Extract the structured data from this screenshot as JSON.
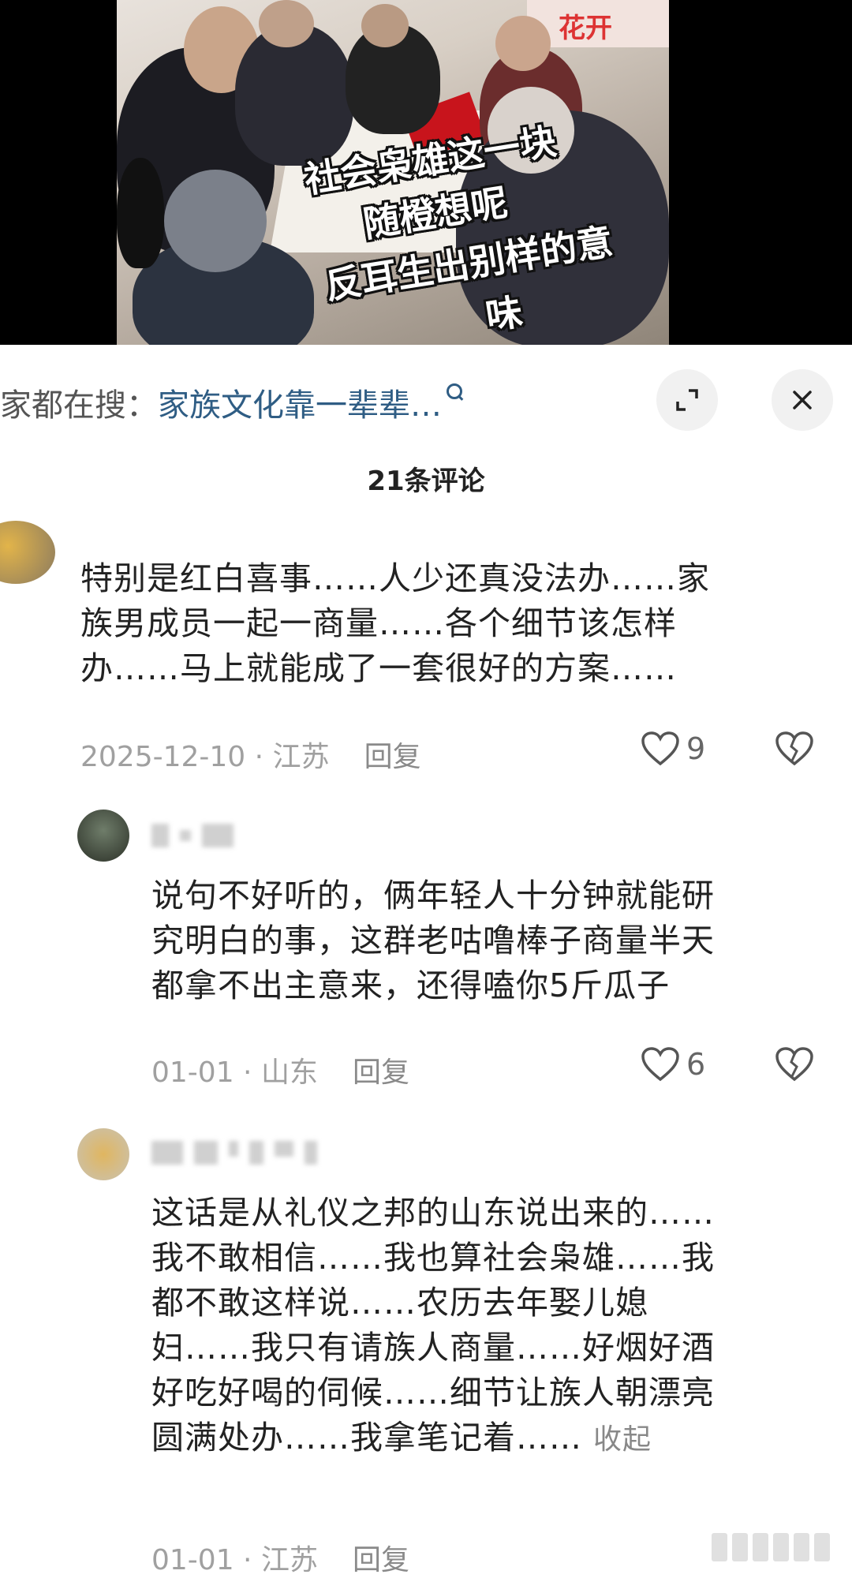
{
  "video": {
    "overlay_lines": [
      "社会枭雄这一块",
      "随橙想呢",
      "反耳生出别样的意",
      "味"
    ],
    "banner_text": "花开"
  },
  "search": {
    "prefix": "家都在搜：",
    "term": "家族文化靠一辈辈…"
  },
  "buttons": {
    "expand_icon": "expand-icon",
    "close_icon": "close-icon"
  },
  "comments_header": "21条评论",
  "comments": [
    {
      "lines": [
        "特别是红白喜事……人少还真没法办……家",
        "族男成员一起一商量……各个细节该怎样",
        "办……马上就能成了一套很好的方案……"
      ],
      "date": "2025-12-10",
      "region": "江苏",
      "reply": "回复",
      "likes": "9"
    },
    {
      "lines": [
        "说句不好听的，俩年轻人十分钟就能研",
        "究明白的事，这群老咕噜棒子商量半天",
        "都拿不出主意来，还得嗑你5斤瓜子"
      ],
      "date": "01-01",
      "region": "山东",
      "reply": "回复",
      "likes": "6"
    },
    {
      "lines": [
        "这话是从礼仪之邦的山东说出来的……",
        "我不敢相信……我也算社会枭雄……我",
        "都不敢这样说……农历去年娶儿媳",
        "妇……我只有请族人商量……好烟好酒",
        "好吃好喝的伺候……细节让族人朝漂亮",
        "圆满处办……我拿笔记着……"
      ],
      "collapse": "收起",
      "date": "01-01",
      "region": "江苏",
      "reply": "回复"
    }
  ],
  "colors": {
    "search_term": "#2f5d84",
    "meta_gray": "#a0a0a0"
  }
}
